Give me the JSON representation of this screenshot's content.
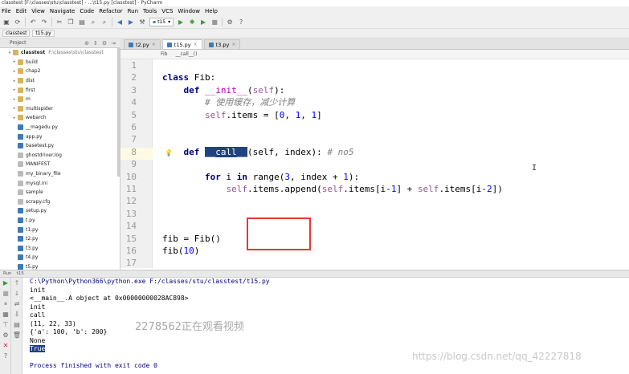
{
  "window_title": "classtest [F:\\classes\\stu\\classtest] - ...\\t15.py [classtest] - PyCharm",
  "menu": [
    "File",
    "Edit",
    "View",
    "Navigate",
    "Code",
    "Refactor",
    "Run",
    "Tools",
    "VCS",
    "Window",
    "Help"
  ],
  "toolbar": {
    "run_config": "t15"
  },
  "navbar": {
    "crumbs": [
      "classtest",
      "t15.py"
    ]
  },
  "project_panel": {
    "header_label": "Project",
    "root_name": "classtest",
    "root_path": "F:\\classes\\stu\\classtest",
    "items": [
      {
        "name": "build",
        "type": "folder"
      },
      {
        "name": "chap2",
        "type": "folder"
      },
      {
        "name": "dist",
        "type": "folder"
      },
      {
        "name": "first",
        "type": "folder"
      },
      {
        "name": "m",
        "type": "folder"
      },
      {
        "name": "multispider",
        "type": "folder"
      },
      {
        "name": "webarch",
        "type": "folder"
      },
      {
        "name": "__magedu.py",
        "type": "py"
      },
      {
        "name": "app.py",
        "type": "py"
      },
      {
        "name": "basetest.py",
        "type": "py"
      },
      {
        "name": "ghostdriver.log",
        "type": "txt"
      },
      {
        "name": "MANIFEST",
        "type": "txt"
      },
      {
        "name": "my_binary_file",
        "type": "txt"
      },
      {
        "name": "mysql.ini",
        "type": "txt"
      },
      {
        "name": "sample",
        "type": "txt"
      },
      {
        "name": "scrapy.cfg",
        "type": "txt"
      },
      {
        "name": "setup.py",
        "type": "py"
      },
      {
        "name": "t.py",
        "type": "py"
      },
      {
        "name": "t1.py",
        "type": "py"
      },
      {
        "name": "t2.py",
        "type": "py"
      },
      {
        "name": "t3.py",
        "type": "py"
      },
      {
        "name": "t4.py",
        "type": "py"
      },
      {
        "name": "t5.py",
        "type": "py"
      }
    ]
  },
  "editor": {
    "tabs": [
      {
        "label": "t2.py",
        "active": false
      },
      {
        "label": "t15.py",
        "active": true
      },
      {
        "label": "t3.py",
        "active": false
      }
    ],
    "breadcrumb": [
      "Fib",
      "__call__()"
    ],
    "line_numbers": [
      "1",
      "2",
      "3",
      "4",
      "5",
      "6",
      "7",
      "8",
      "9",
      "10",
      "11",
      "12",
      "13",
      "14",
      "15",
      "16",
      "17"
    ],
    "code": {
      "l2_kw": "class",
      "l2_rest": " Fib:",
      "l3_kw": "def",
      "l3_name": "__init__",
      "l3_open": "(",
      "l3_self": "self",
      "l3_close": "):",
      "l4_comment": "# 使用缓存，减少计算",
      "l5_self": "self",
      "l5_mid": ".items = [",
      "l5_n0": "0",
      "l5_c1": ", ",
      "l5_n1": "1",
      "l5_c2": ", ",
      "l5_n2": "1",
      "l5_end": "]",
      "l8_kw": "def",
      "l8_name": "__call__",
      "l8_args": "(self, index):",
      "l8_comment": "# no5",
      "l10_for": "for",
      "l10_i": " i ",
      "l10_in": "in",
      "l10_range": " range(",
      "l10_n3": "3",
      "l10_mid": ", index + ",
      "l10_n1": "1",
      "l10_end": "):",
      "l11_self1": "self",
      "l11_a": ".items.append(",
      "l11_self2": "self",
      "l11_b": ".items[i-",
      "l11_n1": "1",
      "l11_c": "] + ",
      "l11_self3": "self",
      "l11_d": ".items[i-",
      "l11_n2": "2",
      "l11_e": "])",
      "l15": "fib = Fib()",
      "l16_a": "fib(",
      "l16_n": "10",
      "l16_b": ")"
    }
  },
  "run_panel": {
    "header_label": "Run",
    "config": "t15",
    "output": [
      "C:\\Python\\Python366\\python.exe F:/classes/stu/classtest/t15.py",
      "init",
      "<__main__.A object at 0x00000000028AC898>",
      "init",
      "call",
      "(11, 22, 33)",
      "{'a': 100, 'b': 200}",
      "None",
      "True",
      "",
      "Process finished with exit code 0"
    ]
  },
  "overlay_text": "2278562正在观看视频",
  "watermark": "https://blog.csdn.net/qq_42227818"
}
